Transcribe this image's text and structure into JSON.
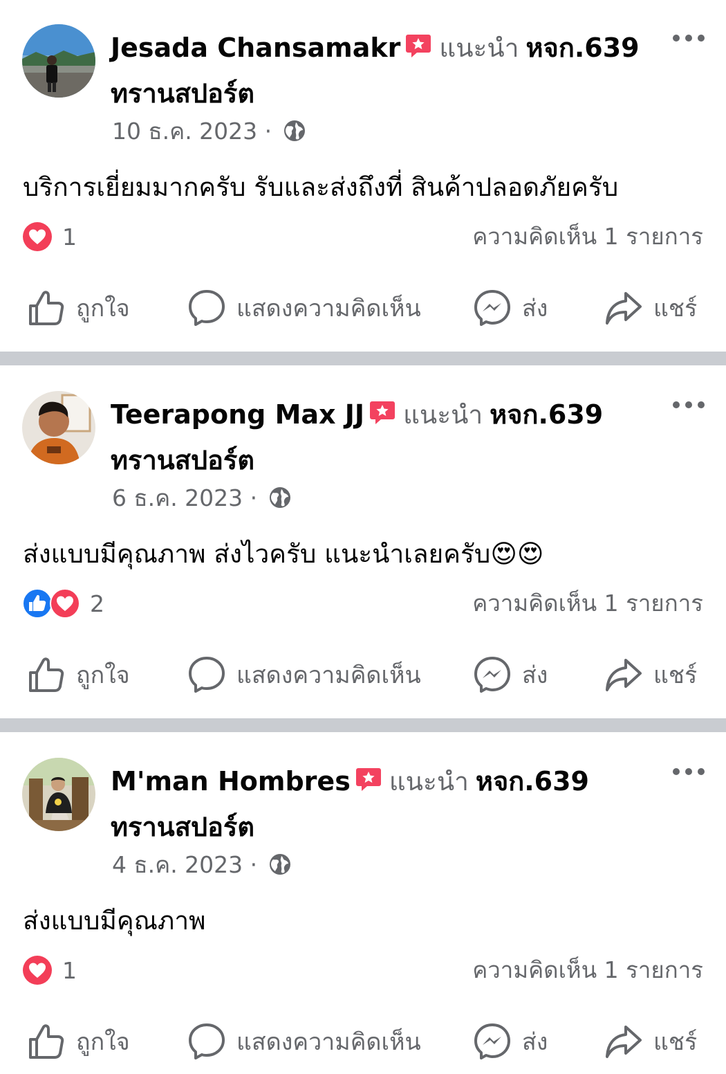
{
  "posts": [
    {
      "author": "Jesada Chansamakr",
      "recommend_text": "แนะนำ",
      "page_line1": "หจก.639",
      "page_line2": "ทรานสปอร์ต",
      "date": "10 ธ.ค. 2023",
      "separator": "·",
      "body": "บริการเยี่ยมมากครับ รับและส่งถึงที่ สินค้าปลอดภัยครับ",
      "reactions": [
        "love"
      ],
      "reaction_count": "1",
      "comments": "ความคิดเห็น 1 รายการ"
    },
    {
      "author": "Teerapong Max JJ",
      "recommend_text": "แนะนำ",
      "page_line1": "หจก.639",
      "page_line2": "ทรานสปอร์ต",
      "date": "6 ธ.ค. 2023",
      "separator": "·",
      "body": "ส่งแบบมีคุณภาพ ส่งไวครับ แนะนำเลยครับ😍😍",
      "reactions": [
        "like",
        "love"
      ],
      "reaction_count": "2",
      "comments": "ความคิดเห็น 1 รายการ"
    },
    {
      "author": "M'man Hombres",
      "recommend_text": "แนะนำ",
      "page_line1": "หจก.639",
      "page_line2": "ทรานสปอร์ต",
      "date": "4 ธ.ค. 2023",
      "separator": "·",
      "body": "ส่งแบบมีคุณภาพ",
      "reactions": [
        "love"
      ],
      "reaction_count": "1",
      "comments": "ความคิดเห็น 1 รายการ"
    }
  ],
  "actions": {
    "like": "ถูกใจ",
    "comment": "แสดงความคิดเห็น",
    "send": "ส่ง",
    "share": "แชร์"
  },
  "colors": {
    "secondary_text": "#65676b",
    "divider": "#c9ccd1",
    "love": "#f33e58",
    "like": "#1877f2",
    "recommend_badge": "#f3425f"
  },
  "icons": [
    "recommend-badge-icon",
    "more-options-icon",
    "globe-icon",
    "love-reaction-icon",
    "like-reaction-icon",
    "thumbs-up-icon",
    "comment-bubble-icon",
    "messenger-icon",
    "share-arrow-icon"
  ]
}
